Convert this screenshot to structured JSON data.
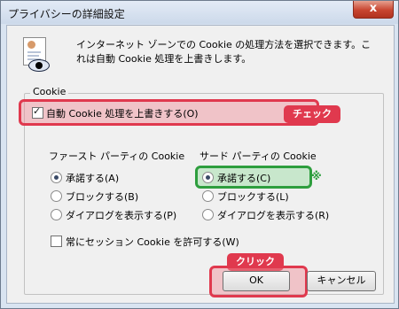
{
  "window": {
    "title": "プライバシーの詳細設定",
    "close_label": "x"
  },
  "intro_text": "インターネット ゾーンでの Cookie の処理方法を選択できます。これは自動 Cookie 処理を上書きします。",
  "cookie_group": {
    "label": "Cookie",
    "override_checkbox": {
      "label": "自動 Cookie 処理を上書きする(O)",
      "checked": true
    },
    "first_party": {
      "heading": "ファースト パーティの Cookie",
      "options": [
        "承諾する(A)",
        "ブロックする(B)",
        "ダイアログを表示する(P)"
      ],
      "selected": "承諾する(A)"
    },
    "third_party": {
      "heading": "サード パーティの Cookie",
      "options": [
        "承諾する(C)",
        "ブロックする(L)",
        "ダイアログを表示する(R)"
      ],
      "selected": "承諾する(C)"
    },
    "session_checkbox": {
      "label": "常にセッション Cookie を許可する(W)",
      "checked": false
    }
  },
  "annotations": {
    "check_badge": "チェック",
    "click_badge": "クリック",
    "mark": "※"
  },
  "buttons": {
    "ok": "OK",
    "cancel": "キャンセル"
  },
  "colors": {
    "highlight_red": "#e0394e",
    "highlight_green": "#2e9e3e"
  }
}
